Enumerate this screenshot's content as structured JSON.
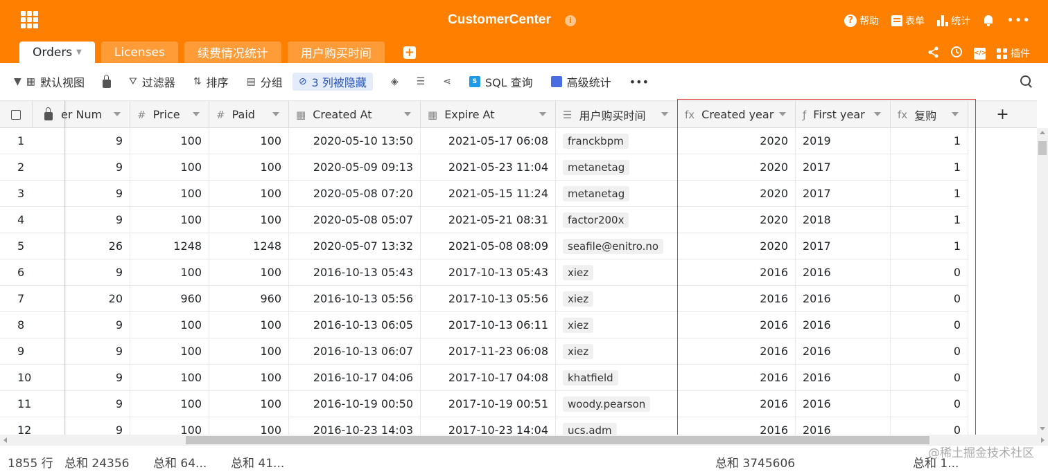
{
  "app": {
    "title": "CustomerCenter",
    "info_glyph": "i",
    "actions": {
      "help": "帮助",
      "form": "表单",
      "stats": "统计",
      "more": "•••"
    }
  },
  "tabs": [
    {
      "label": "Orders"
    },
    {
      "label": "Licenses"
    },
    {
      "label": "续费情况统计"
    },
    {
      "label": "用户购买时间"
    }
  ],
  "tab_add": "+",
  "tab_right": {
    "plugin": "插件",
    "code_glyph": "</>"
  },
  "toolbar": {
    "view": "默认视图",
    "filter": "过滤器",
    "sort": "排序",
    "group": "分组",
    "hidden_cols": "3 列被隐藏",
    "sql": "SQL 查询",
    "advanced": "高级统计",
    "more": "•••"
  },
  "columns": [
    {
      "name": "er Num",
      "icon": ""
    },
    {
      "name": "Price",
      "icon": "#"
    },
    {
      "name": "Paid",
      "icon": "#"
    },
    {
      "name": "Created At",
      "icon": "▦"
    },
    {
      "name": "Expire At",
      "icon": "▦"
    },
    {
      "name": "用户购买时间",
      "icon": "☰"
    },
    {
      "name": "Created year",
      "icon": "fx"
    },
    {
      "name": "First year",
      "icon": "ƒ"
    },
    {
      "name": "复购",
      "icon": "fx"
    }
  ],
  "add_column": "+",
  "rows": [
    [
      "1",
      "9",
      "100",
      "100",
      "2020-05-10 13:50",
      "2021-05-17 06:08",
      "franckbpm",
      "2020",
      "2019",
      "1"
    ],
    [
      "2",
      "9",
      "100",
      "100",
      "2020-05-09 09:13",
      "2021-05-23 11:04",
      "metanetag",
      "2020",
      "2017",
      "1"
    ],
    [
      "3",
      "9",
      "100",
      "100",
      "2020-05-08 07:20",
      "2021-05-15 11:24",
      "metanetag",
      "2020",
      "2017",
      "1"
    ],
    [
      "4",
      "9",
      "100",
      "100",
      "2020-05-08 05:07",
      "2021-05-21 08:31",
      "factor200x",
      "2020",
      "2018",
      "1"
    ],
    [
      "5",
      "26",
      "1248",
      "1248",
      "2020-05-07 13:32",
      "2021-05-08 08:09",
      "seafile@enitro.no",
      "2020",
      "2017",
      "1"
    ],
    [
      "6",
      "9",
      "100",
      "100",
      "2016-10-13 05:43",
      "2017-10-13 05:43",
      "xiez",
      "2016",
      "2016",
      "0"
    ],
    [
      "7",
      "20",
      "960",
      "960",
      "2016-10-13 05:56",
      "2017-10-13 05:56",
      "xiez",
      "2016",
      "2016",
      "0"
    ],
    [
      "8",
      "9",
      "100",
      "100",
      "2016-10-13 06:05",
      "2017-10-13 06:11",
      "xiez",
      "2016",
      "2016",
      "0"
    ],
    [
      "9",
      "9",
      "100",
      "100",
      "2016-10-13 06:07",
      "2017-11-23 06:08",
      "xiez",
      "2016",
      "2016",
      "0"
    ],
    [
      "10",
      "9",
      "100",
      "100",
      "2016-10-17 04:06",
      "2017-10-17 04:08",
      "khatfield",
      "2016",
      "2016",
      "0"
    ],
    [
      "11",
      "9",
      "100",
      "100",
      "2016-10-19 00:50",
      "2017-10-19 00:51",
      "woody.pearson",
      "2016",
      "2016",
      "0"
    ],
    [
      "12",
      "9",
      "100",
      "100",
      "2016-10-23 14:03",
      "2017-10-23 14:04",
      "ucs.adm",
      "2016",
      "2016",
      "0"
    ]
  ],
  "footer": {
    "row_count": "1855 行",
    "sum1": "总和 24356",
    "sum2": "总和 64...",
    "sum3": "总和 41...",
    "sum4": "总和 3745606",
    "sum5": "总和 1..."
  },
  "watermark": "@稀土掘金技术社区",
  "colors": {
    "brand": "#ff8000",
    "highlight_border": "#e03b3b",
    "hidden_badge": "#e4ecf9"
  }
}
